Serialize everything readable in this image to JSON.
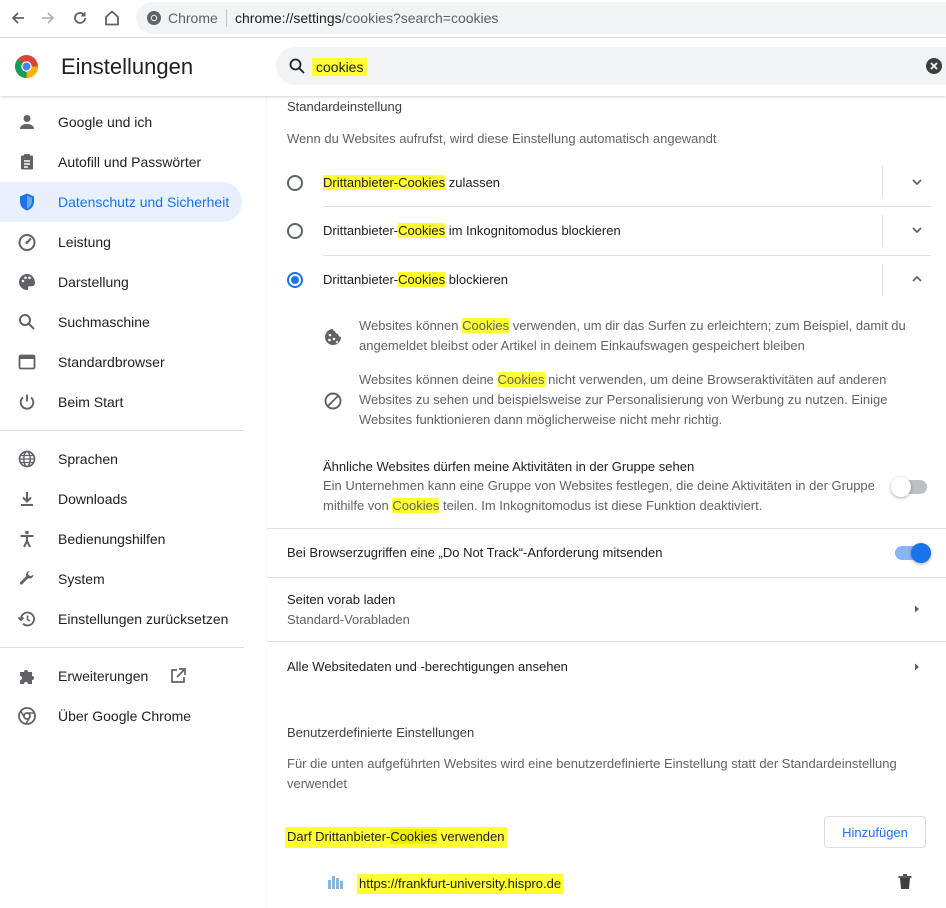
{
  "browser": {
    "omnibox_site": "Chrome",
    "omnibox_url_host": "chrome://settings",
    "omnibox_url_path": "/cookies?search=cookies"
  },
  "header": {
    "title": "Einstellungen",
    "search_value": "cookies"
  },
  "sidebar": {
    "items": [
      {
        "label": "Google und ich",
        "icon": "person-icon"
      },
      {
        "label": "Autofill und Passwörter",
        "icon": "clipboard-icon"
      },
      {
        "label": "Datenschutz und Sicherheit",
        "icon": "shield-icon",
        "active": true
      },
      {
        "label": "Leistung",
        "icon": "speedometer-icon"
      },
      {
        "label": "Darstellung",
        "icon": "palette-icon"
      },
      {
        "label": "Suchmaschine",
        "icon": "search-icon"
      },
      {
        "label": "Standardbrowser",
        "icon": "browser-window-icon"
      },
      {
        "label": "Beim Start",
        "icon": "power-icon"
      },
      {
        "label": "Sprachen",
        "icon": "globe-icon"
      },
      {
        "label": "Downloads",
        "icon": "download-icon"
      },
      {
        "label": "Bedienungshilfen",
        "icon": "accessibility-icon"
      },
      {
        "label": "System",
        "icon": "wrench-icon"
      },
      {
        "label": "Einstellungen zurücksetzen",
        "icon": "history-icon"
      },
      {
        "label": "Erweiterungen",
        "icon": "puzzle-icon"
      },
      {
        "label": "Über Google Chrome",
        "icon": "chrome-icon"
      }
    ]
  },
  "main": {
    "default_title": "Standardeinstellung",
    "default_desc": "Wenn du Websites aufrufst, wird diese Einstellung automatisch angewandt",
    "options": [
      {
        "pre": "",
        "hl": "Drittanbieter-Cookies",
        "post": " zulassen",
        "selected": false
      },
      {
        "pre": "Drittanbieter-",
        "hl": "Cookies",
        "post": " im Inkognitomodus blockieren",
        "selected": false
      },
      {
        "pre": "Drittanbieter-",
        "hl": "Cookies",
        "post": " blockieren",
        "selected": true
      }
    ],
    "expanded": {
      "bullet1_pre": "Websites können ",
      "bullet1_hl": "Cookies",
      "bullet1_post": " verwenden, um dir das Surfen zu erleichtern; zum Beispiel, damit du",
      "bullet1_line2": "angemeldet bleibst oder Artikel in deinem Einkaufswagen gespeichert bleiben",
      "bullet2_pre": "Websites können deine ",
      "bullet2_hl": "Cookies",
      "bullet2_post": " nicht verwenden, um deine Browseraktivitäten auf anderen",
      "bullet2_line2": "Websites zu sehen und beispielsweise zur Personalisierung von Werbung zu nutzen. Einige",
      "bullet2_line3": "Websites funktionieren dann möglicherweise nicht mehr richtig.",
      "group_title": "Ähnliche Websites dürfen meine Aktivitäten in der Gruppe sehen",
      "group_line1": "Ein Unternehmen kann eine Gruppe von Websites festlegen, die deine Aktivitäten in der Gruppe",
      "group_line2_pre": "mithilfe von ",
      "group_line2_hl": "Cookies",
      "group_line2_post": " teilen. Im Inkognitomodus ist diese Funktion deaktiviert.",
      "group_toggle_on": false
    },
    "dnt_label": "Bei Browserzugriffen eine „Do Not Track“-Anforderung mitsenden",
    "dnt_on": true,
    "preload_title": "Seiten vorab laden",
    "preload_sub": "Standard-Vorabladen",
    "all_sites": "Alle Websitedaten und -berechtigungen ansehen",
    "custom_title": "Benutzerdefinierte Einstellungen",
    "custom_desc_line1": "Für die unten aufgeführten Websites wird eine benutzerdefinierte Einstellung statt der Standardeinstellung",
    "custom_desc_line2": "verwendet",
    "allow_pre": "Darf Drittanbieter-",
    "allow_hl": "Cookies",
    "allow_post": " verwenden",
    "add_button": "Hinzufügen",
    "site_url": "https://frankfurt-university.hispro.de"
  },
  "colors": {
    "accent": "#1a73e8",
    "highlight": "#ffff33"
  }
}
